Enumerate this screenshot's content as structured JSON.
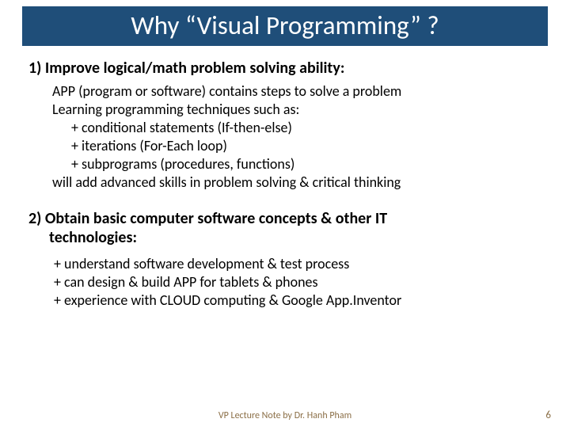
{
  "title": "Why “Visual Programming” ?",
  "section1": {
    "heading": "1) Improve logical/math problem solving ability:",
    "line1": "APP (program or software) contains steps to solve a problem",
    "line2": "Learning programming techniques such as:",
    "bullets": [
      "+ conditional statements (If-then-else)",
      "+ iterations (For-Each loop)",
      "+ subprograms (procedures, functions)"
    ],
    "line3": "will add advanced skills in problem solving & critical thinking"
  },
  "section2": {
    "heading_l1": "2) Obtain basic computer software concepts & other IT",
    "heading_l2": "technologies:",
    "bullets": [
      "+ understand software development & test process",
      "+ can design & build APP for tablets & phones",
      "+ experience with CLOUD computing & Google App.Inventor"
    ]
  },
  "footer": "VP Lecture Note by Dr. Hanh Pham",
  "page": "6"
}
